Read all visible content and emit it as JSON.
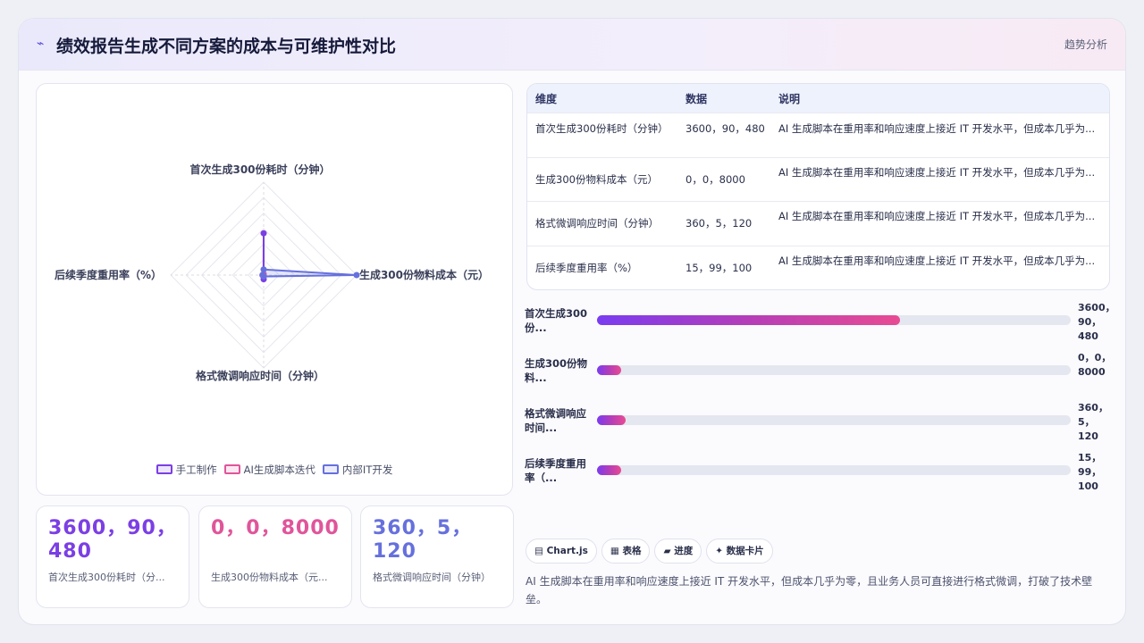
{
  "header": {
    "icon": "pulse-icon",
    "title": "绩效报告生成不同方案的成本与可维护性对比",
    "trend_label": "趋势分析"
  },
  "chart_data": {
    "type": "radar",
    "axes": [
      "首次生成300份耗时（分钟）",
      "生成300份物料成本（元）",
      "格式微调响应时间（分钟）",
      "后续季度重用率（%）"
    ],
    "series": [
      {
        "name": "手工制作",
        "values": [
          3600,
          0,
          360,
          15
        ],
        "color": "#7b3fe4"
      },
      {
        "name": "AI生成脚本迭代",
        "values": [
          90,
          0,
          5,
          99
        ],
        "color": "#e0559a"
      },
      {
        "name": "内部IT开发",
        "values": [
          480,
          8000,
          120,
          100
        ],
        "color": "#6670dd"
      }
    ],
    "scale": "shared-linear",
    "max": 8000,
    "grid": true,
    "legend_position": "bottom"
  },
  "stats": [
    {
      "value": "3600，90，480",
      "label": "首次生成300份耗时（分...",
      "color": "#7b3fe4"
    },
    {
      "value": "0，0，8000",
      "label": "生成300份物料成本（元...",
      "color": "#e0559a"
    },
    {
      "value": "360，5，120",
      "label": "格式微调响应时间（分钟）",
      "color": "#6670dd"
    }
  ],
  "table": {
    "headers": [
      "维度",
      "数据",
      "说明"
    ],
    "rows": [
      [
        "首次生成300份耗时（分钟）",
        "3600，90，480",
        "AI 生成脚本在重用率和响应速度上接近 IT 开发水平，但成本几乎为..."
      ],
      [
        "生成300份物料成本（元）",
        "0，0，8000",
        "AI 生成脚本在重用率和响应速度上接近 IT 开发水平，但成本几乎为..."
      ],
      [
        "格式微调响应时间（分钟）",
        "360，5，120",
        "AI 生成脚本在重用率和响应速度上接近 IT 开发水平，但成本几乎为..."
      ],
      [
        "后续季度重用率（%）",
        "15，99，100",
        "AI 生成脚本在重用率和响应速度上接近 IT 开发水平，但成本几乎为..."
      ]
    ]
  },
  "bars": [
    {
      "label": "首次生成300份...",
      "value": "3600，90，480",
      "fill": 0.64
    },
    {
      "label": "生成300份物料...",
      "value": "0，0，8000",
      "fill": 0.05
    },
    {
      "label": "格式微调响应时间...",
      "value": "360，5，120",
      "fill": 0.06
    },
    {
      "label": "后续季度重用率（...",
      "value": "15，99，100",
      "fill": 0.05
    }
  ],
  "chips": [
    "▤ Chart.js",
    "▦ 表格",
    "▰ 进度",
    "✦ 数据卡片"
  ],
  "summary": "AI 生成脚本在重用率和响应速度上接近 IT 开发水平，但成本几乎为零，且业务人员可直接进行格式微调，打破了技术壁垒。"
}
